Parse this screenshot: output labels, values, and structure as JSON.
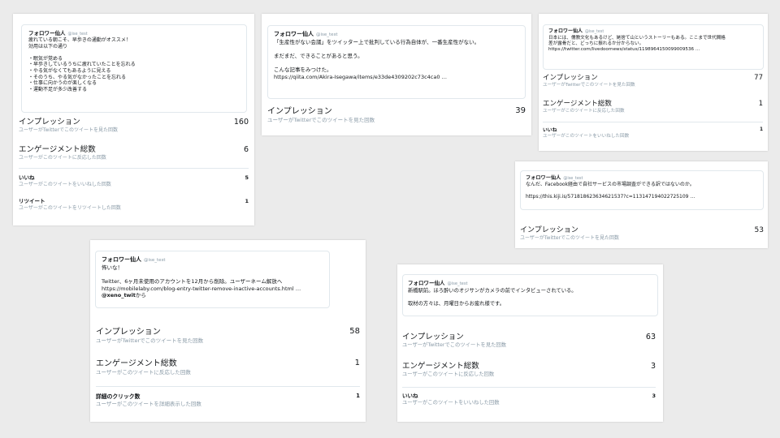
{
  "author": {
    "name": "フォロワー仙人",
    "handle": "@ise_test"
  },
  "cards": [
    {
      "tweet_lines": [
        "疲れている朝こそ、早歩きの通勤がオススメ！",
        "効用は以下の通り",
        "",
        "・眠気が覚める",
        "・早歩きしているうちに疲れていたことを忘れる",
        "・やる気がなくてもあるように見える",
        "・そのうち、やる気がなかったことを忘れる",
        "・仕事に向かうのが楽しくなる",
        "・運動不足が多少改善する"
      ],
      "metrics": [
        {
          "title": "インプレッション",
          "sub": "ユーザーがTwitterでこのツイートを見た回数",
          "value": "160"
        },
        {
          "title": "エンゲージメント総数",
          "sub": "ユーザーがこのツイートに反応した回数",
          "value": "6"
        },
        {
          "title": "いいね",
          "sub": "ユーザーがこのツイートをいいねした回数",
          "value": "5"
        },
        {
          "title": "リツイート",
          "sub": "ユーザーがこのツイートをリツイートした回数",
          "value": "1"
        }
      ]
    },
    {
      "tweet_lines": [
        "「生産性がない会議」をツイッター上で批判している行為自体が、一番生産性がない。",
        "",
        "まだまだ、できることがあると思う。",
        "",
        "こんな記事をみつけた。",
        "https://qiita.com/Akira-Isegawa/items/e33de4309202c73c4ca0 …"
      ],
      "metrics": [
        {
          "title": "インプレッション",
          "sub": "ユーザーがTwitterでこのツイートを見た回数",
          "value": "39"
        }
      ]
    },
    {
      "tweet_lines": [
        "日本には、儒教文化もあるけど、姥捨て山というストーリーもある。ここまで世代間格",
        "差が露骨だと、どっちに振れるか分からない。",
        "https://twitter.com/livedoornews/status/1198964150099009536 …"
      ],
      "metrics": [
        {
          "title": "インプレッション",
          "sub": "ユーザーがTwitterでこのツイートを見た回数",
          "value": "77"
        },
        {
          "title": "エンゲージメント総数",
          "sub": "ユーザーがこのツイートに反応した回数",
          "value": "1"
        },
        {
          "title": "いいね",
          "sub": "ユーザーがこのツイートをいいねした回数",
          "value": "1"
        }
      ]
    },
    {
      "tweet_lines": [
        "なんだ、Facebook経由で自社サービスの市場調査ができる訳ではないのか。",
        "",
        "https://this.kiji.is/571818623634621537?c=113147194022725109 …"
      ],
      "metrics": [
        {
          "title": "インプレッション",
          "sub": "ユーザーがTwitterでこのツイートを見た回数",
          "value": "53"
        }
      ]
    },
    {
      "tweet_lines": [
        "怖いな！",
        "",
        "Twitter、6ヶ月未使用のアカウントを12月から削除。ユーザーネーム解放へ",
        "https://mobilelaby.com/blog-entry-twitter-remove-inactive-accounts.html …"
      ],
      "tweet_mention": "@xeno_twit",
      "tweet_mention_suffix": "から",
      "metrics": [
        {
          "title": "インプレッション",
          "sub": "ユーザーがTwitterでこのツイートを見た回数",
          "value": "58"
        },
        {
          "title": "エンゲージメント総数",
          "sub": "ユーザーがこのツイートに反応した回数",
          "value": "1"
        },
        {
          "title": "詳細のクリック数",
          "sub": "ユーザーがこのツイートを詳細表示した回数",
          "value": "1"
        }
      ]
    },
    {
      "tweet_lines": [
        "新橋駅前。ほろ酔いのオジサンがカメラの前でインタビューされている。",
        "",
        "取材の方々は、月曜日からお疲れ様です。"
      ],
      "metrics": [
        {
          "title": "インプレッション",
          "sub": "ユーザーがTwitterでこのツイートを見た回数",
          "value": "63"
        },
        {
          "title": "エンゲージメント総数",
          "sub": "ユーザーがこのツイートに反応した回数",
          "value": "3"
        },
        {
          "title": "いいね",
          "sub": "ユーザーがこのツイートをいいねした回数",
          "value": "3"
        }
      ]
    }
  ]
}
